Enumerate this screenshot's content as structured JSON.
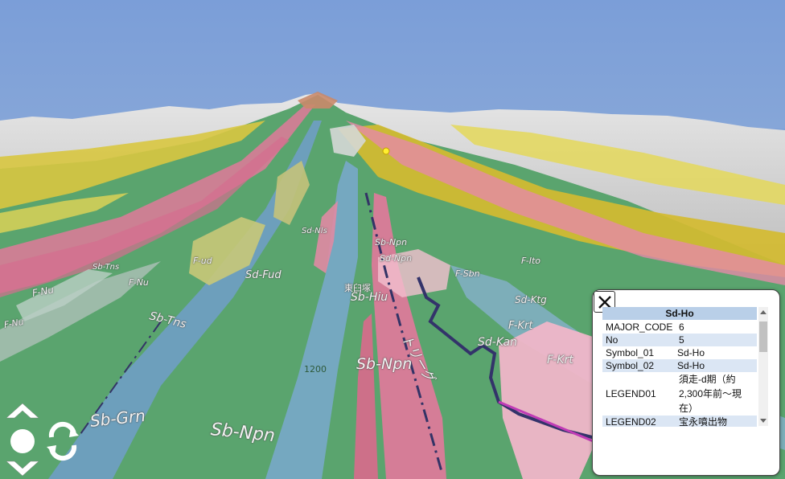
{
  "colors": {
    "sky": "#7d9fd6",
    "green": "#5aa46e",
    "blue_flow": "#6f9fc4",
    "pink": "#e07a9a",
    "yellow": "#d8c640",
    "light_pink": "#f0b6c8",
    "terrain": "#cfcfcf",
    "popup_header": "#b9cfe8"
  },
  "map": {
    "labels": [
      {
        "text": "Sb-Grn",
        "size": "large"
      },
      {
        "text": "Sb-Npn",
        "size": "large"
      },
      {
        "text": "Sb-Npn",
        "size": "large"
      },
      {
        "text": "Sb-Tns",
        "size": "medium"
      },
      {
        "text": "Sb-Hiu",
        "size": "medium"
      },
      {
        "text": "Sd-Fud",
        "size": "medium"
      },
      {
        "text": "F-Nu",
        "size": "medium"
      },
      {
        "text": "F-Nu",
        "size": "small"
      },
      {
        "text": "F-Nu",
        "size": "small"
      },
      {
        "text": "Sb-Tns",
        "size": "small"
      },
      {
        "text": "F-ud",
        "size": "small"
      },
      {
        "text": "Sd-Nls",
        "size": "small"
      },
      {
        "text": "Sd-Npn",
        "size": "small"
      },
      {
        "text": "Sb-Npn",
        "size": "small"
      },
      {
        "text": "Sd-Ktg",
        "size": "small"
      },
      {
        "text": "F-Krt",
        "size": "medium"
      },
      {
        "text": "Sd-Kan",
        "size": "medium"
      },
      {
        "text": "F-Krt",
        "size": "medium"
      },
      {
        "text": "F-Sbn",
        "size": "small"
      },
      {
        "text": "F-Ito",
        "size": "small"
      },
      {
        "text": "1200",
        "size": "small"
      },
      {
        "text": "東臼塚",
        "size": "small"
      },
      {
        "text": "トリーグ",
        "size": "medium"
      }
    ]
  },
  "nav": {
    "up_icon": "chevron-up-icon",
    "down_icon": "chevron-down-icon",
    "center_icon": "circle-icon",
    "rotate_icon": "rotate-icon"
  },
  "popup": {
    "title": "Sd-Ho",
    "close_icon": "close-icon",
    "rows": [
      {
        "key": "MAJOR_CODE",
        "value": "6"
      },
      {
        "key": "No",
        "value": "5"
      },
      {
        "key": "Symbol_01",
        "value": "Sd-Ho"
      },
      {
        "key": "Symbol_02",
        "value": "Sd-Ho"
      },
      {
        "key": "LEGEND01",
        "value": "須走-d期（約2,300年前〜現在）"
      },
      {
        "key": "LEGEND02",
        "value": "宝永噴出物"
      }
    ]
  }
}
